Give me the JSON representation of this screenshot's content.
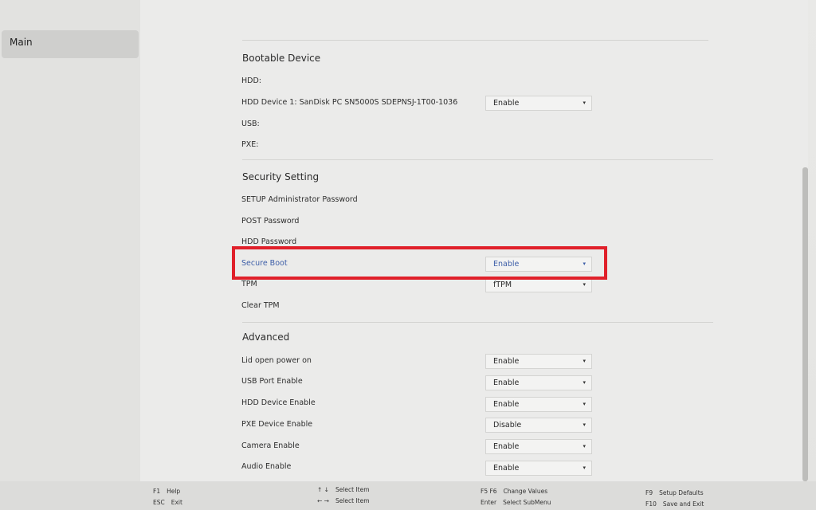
{
  "sidebar": {
    "items": [
      {
        "label": "Main"
      }
    ]
  },
  "bootable": {
    "title": "Bootable Device",
    "rows": [
      {
        "label": "HDD:"
      },
      {
        "label": "HDD Device 1: SanDisk PC SN5000S SDEPNSJ-1T00-1036",
        "value": "Enable"
      },
      {
        "label": "USB:"
      },
      {
        "label": "PXE:"
      }
    ]
  },
  "security": {
    "title": "Security Setting",
    "rows": [
      {
        "label": "SETUP Administrator Password"
      },
      {
        "label": "POST Password"
      },
      {
        "label": "HDD Password"
      },
      {
        "label": "Secure Boot",
        "value": "Enable"
      },
      {
        "label": "TPM",
        "value": "fTPM"
      },
      {
        "label": "Clear TPM"
      }
    ]
  },
  "advanced": {
    "title": "Advanced",
    "rows": [
      {
        "label": "Lid open power on",
        "value": "Enable"
      },
      {
        "label": "USB Port Enable",
        "value": "Enable"
      },
      {
        "label": "HDD Device Enable",
        "value": "Enable"
      },
      {
        "label": "PXE Device Enable",
        "value": "Disable"
      },
      {
        "label": "Camera Enable",
        "value": "Enable"
      },
      {
        "label": "Audio Enable",
        "value": "Enable"
      }
    ]
  },
  "icons": {
    "dropdown_caret": "▾"
  },
  "footer": {
    "help_key": "F1",
    "help_desc": "Help",
    "exit_key": "ESC",
    "exit_desc": "Exit",
    "select_item_key1": "↑ ↓",
    "select_item_desc1": "Select Item",
    "select_item_key2": "← →",
    "select_item_desc2": "Select Item",
    "change_key": "F5 F6",
    "change_desc": "Change Values",
    "enter_key": "Enter",
    "enter_desc": "Select SubMenu",
    "defaults_key": "F9",
    "defaults_desc": "Setup Defaults",
    "save_key": "F10",
    "save_desc": "Save and Exit"
  },
  "colors": {
    "highlight_text": "#3d5ea8",
    "annotation_box": "#e0202a"
  }
}
